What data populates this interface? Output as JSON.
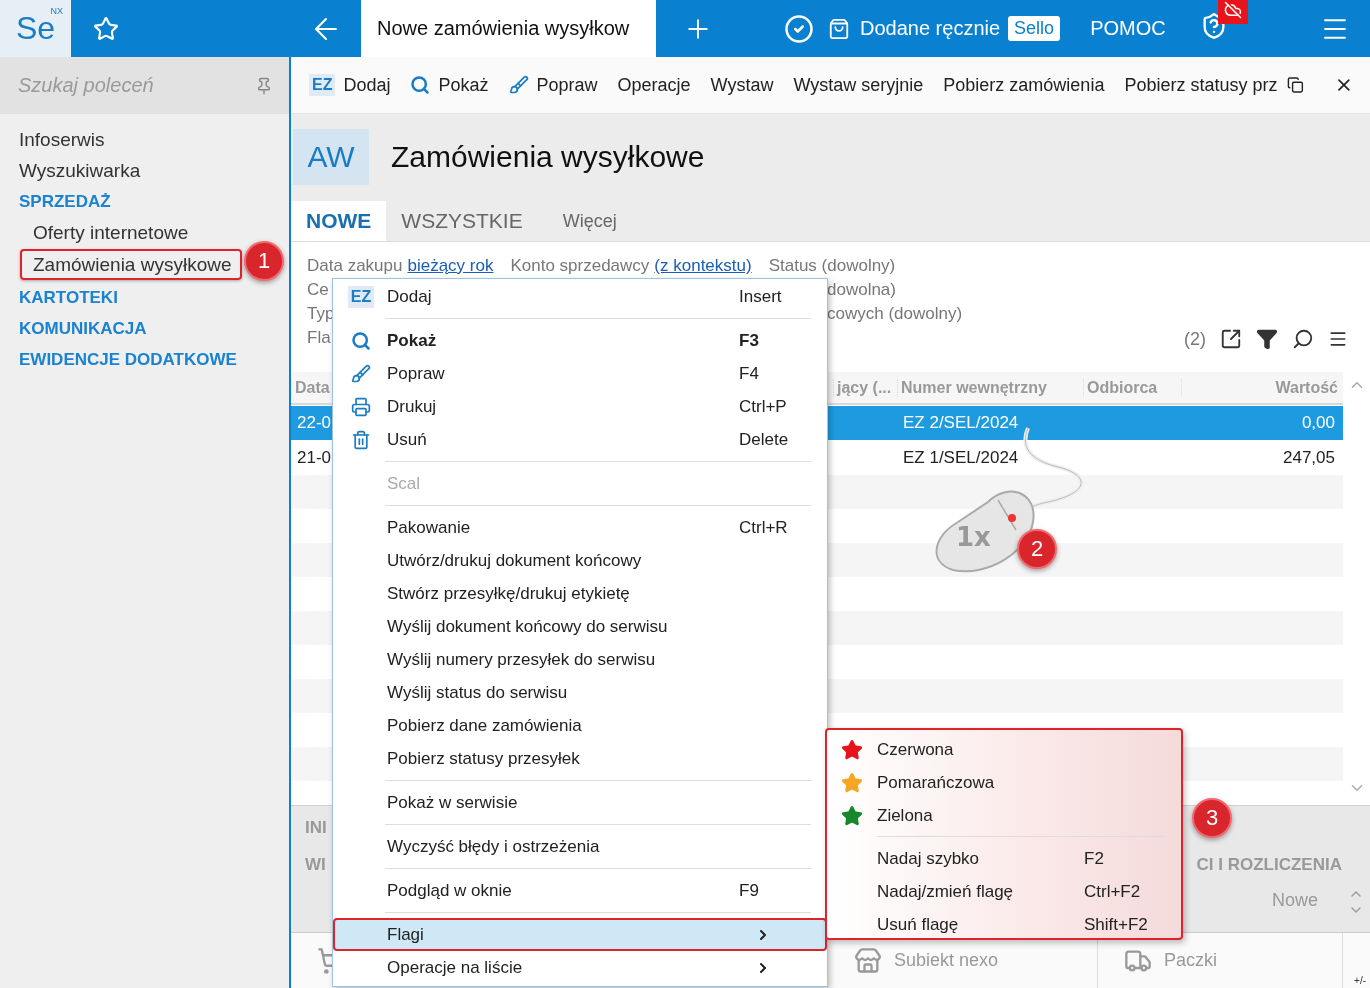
{
  "topbar": {
    "logo": "Se",
    "logo_badge": "NX",
    "tab_title": "Nowe zamówienia wysyłkow",
    "source_label": "Dodane ręcznie",
    "source_badge": "Sello",
    "help": "POMOC"
  },
  "sidebar": {
    "search_placeholder": "Szukaj poleceń",
    "items": [
      {
        "label": "Infoserwis",
        "kind": "link",
        "selected": false
      },
      {
        "label": "Wyszukiwarka",
        "kind": "link",
        "selected": false
      },
      {
        "label": "SPRZEDAŻ",
        "kind": "section",
        "selected": false
      },
      {
        "label": "Oferty internetowe",
        "kind": "subitem",
        "selected": false
      },
      {
        "label": "Zamówienia wysyłkowe",
        "kind": "subitem",
        "selected": true
      },
      {
        "label": "KARTOTEKI",
        "kind": "section",
        "selected": false
      },
      {
        "label": "KOMUNIKACJA",
        "kind": "section",
        "selected": false
      },
      {
        "label": "EWIDENCJE DODATKOWE",
        "kind": "section",
        "selected": false
      }
    ]
  },
  "toolbar": [
    {
      "label": "Dodaj",
      "kind": "badge",
      "badge": "EZ"
    },
    {
      "label": "Pokaż",
      "kind": "search"
    },
    {
      "label": "Popraw",
      "kind": "brush"
    },
    {
      "label": "Operacje",
      "kind": "plain"
    },
    {
      "label": "Wystaw",
      "kind": "plain"
    },
    {
      "label": "Wystaw seryjnie",
      "kind": "plain"
    },
    {
      "label": "Pobierz zamówienia",
      "kind": "plain"
    },
    {
      "label": "Pobierz statusy prz",
      "kind": "plain"
    }
  ],
  "header": {
    "badge": "AW",
    "title": "Zamówienia wysyłkowe"
  },
  "tabs": [
    {
      "label": "NOWE",
      "selected": true,
      "kind": "view"
    },
    {
      "label": "WSZYSTKIE",
      "selected": false,
      "kind": "view"
    },
    {
      "label": "Więcej",
      "selected": false,
      "kind": "more"
    }
  ],
  "filters": [
    {
      "kind": "full",
      "parts": [
        {
          "text": "Data zakupu",
          "link": false
        },
        {
          "text": "bieżący rok",
          "link": true
        },
        {
          "text": "Konto sprzedawcy",
          "link": false
        },
        {
          "text": "(z kontekstu)",
          "link": true
        },
        {
          "text": "Status (dowolny)",
          "link": false
        }
      ]
    },
    {
      "kind": "split",
      "left": "Ce",
      "right": "dowolna)"
    },
    {
      "kind": "split",
      "left": "Typ",
      "right": "cowych (dowolny)"
    },
    {
      "kind": "split",
      "left": "Fla"
    }
  ],
  "list_count": "(2)",
  "table": {
    "columns": [
      "Data",
      "jący (...",
      "Numer wewnętrzny",
      "Odbiorca",
      "Wartość"
    ],
    "rows": [
      {
        "date": "22-0",
        "number": "EZ 2/SEL/2024",
        "value": "0,00",
        "selected": true
      },
      {
        "date": "21-0",
        "number": "EZ 1/SEL/2024",
        "value": "247,05",
        "selected": false
      }
    ]
  },
  "bottom_panel": {
    "tab_1": "INI",
    "tab_2": "WI",
    "tab_3": "CI I ROZLICZENIA",
    "status": "Nowe"
  },
  "bottom_bar": {
    "items": [
      {
        "label": "Subiekt nexo",
        "kind": "store"
      },
      {
        "label": "Paczki",
        "kind": "truck"
      }
    ],
    "corner": "+/-"
  },
  "context_menu": [
    {
      "kind": "badge",
      "label": "Dodaj",
      "badge": "EZ",
      "shortcut": "Insert"
    },
    {
      "kind": "separator"
    },
    {
      "kind": "search",
      "label": "Pokaż",
      "shortcut": "F3",
      "default": true
    },
    {
      "kind": "brush",
      "label": "Popraw",
      "shortcut": "F4"
    },
    {
      "kind": "print",
      "label": "Drukuj",
      "shortcut": "Ctrl+P"
    },
    {
      "kind": "trash",
      "label": "Usuń",
      "shortcut": "Delete"
    },
    {
      "kind": "separator"
    },
    {
      "kind": "item",
      "label": "Scal",
      "disabled": true
    },
    {
      "kind": "separator"
    },
    {
      "kind": "item",
      "label": "Pakowanie",
      "shortcut": "Ctrl+R"
    },
    {
      "kind": "item",
      "label": "Utwórz/drukuj dokument końcowy"
    },
    {
      "kind": "item",
      "label": "Stwórz przesyłkę/drukuj etykietę"
    },
    {
      "kind": "item",
      "label": "Wyślij dokument końcowy do serwisu"
    },
    {
      "kind": "item",
      "label": "Wyślij numery przesyłek do serwisu"
    },
    {
      "kind": "item",
      "label": "Wyślij status do serwisu"
    },
    {
      "kind": "item",
      "label": "Pobierz dane zamówienia"
    },
    {
      "kind": "item",
      "label": "Pobierz statusy przesyłek"
    },
    {
      "kind": "separator"
    },
    {
      "kind": "item",
      "label": "Pokaż w serwisie"
    },
    {
      "kind": "separator"
    },
    {
      "kind": "item",
      "label": "Wyczyść błędy i ostrzeżenia"
    },
    {
      "kind": "separator"
    },
    {
      "kind": "item",
      "label": "Podgląd w oknie",
      "shortcut": "F9"
    },
    {
      "kind": "separator"
    },
    {
      "kind": "item",
      "label": "Flagi",
      "submenu": true,
      "selected": true
    },
    {
      "kind": "item",
      "label": "Operacje na liście",
      "submenu": true,
      "selected": false
    }
  ],
  "flag_menu": [
    {
      "kind": "flag",
      "label": "Czerwona",
      "color": "#e8141b"
    },
    {
      "kind": "flag",
      "label": "Pomarańczowa",
      "color": "#f5a623"
    },
    {
      "kind": "flag",
      "label": "Zielona",
      "color": "#16872b"
    },
    {
      "kind": "separator"
    },
    {
      "kind": "action",
      "label": "Nadaj szybko",
      "shortcut": "F2"
    },
    {
      "kind": "action",
      "label": "Nadaj/zmień flagę",
      "shortcut": "Ctrl+F2"
    },
    {
      "kind": "action",
      "label": "Usuń flagę",
      "shortcut": "Shift+F2"
    }
  ],
  "click_label": "1x",
  "callouts": [
    "1",
    "2",
    "3"
  ]
}
